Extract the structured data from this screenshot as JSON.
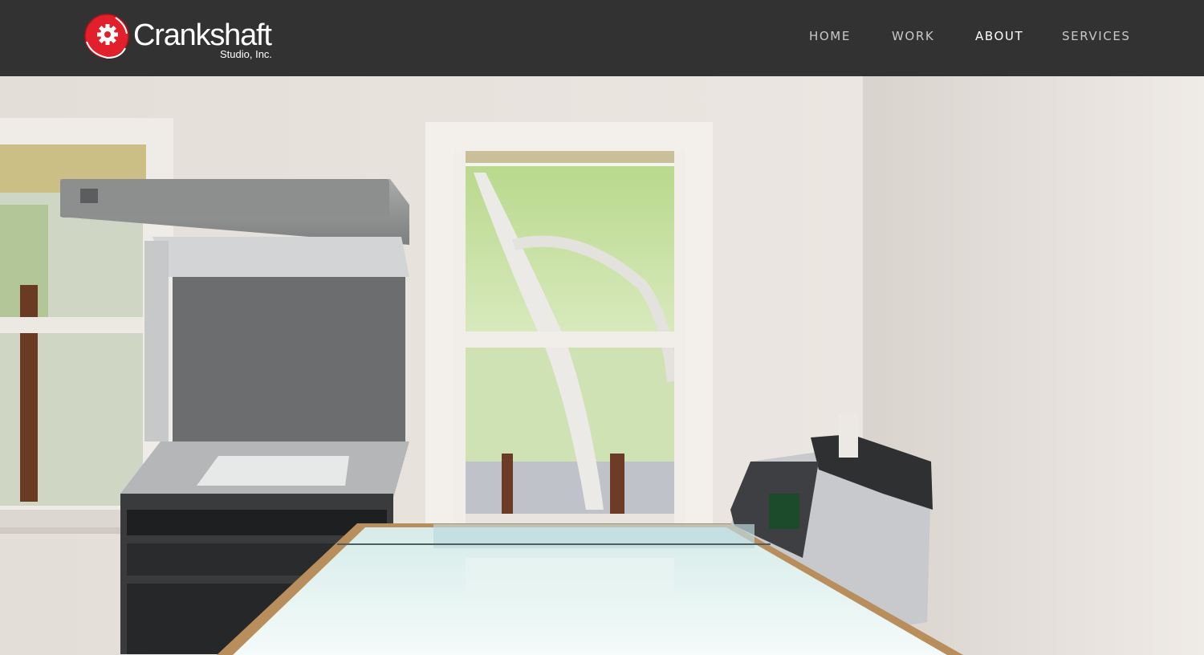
{
  "header": {
    "logo": {
      "name": "Crankshaft",
      "subtitle": "Studio, Inc.",
      "icon": "crankshaft-logo-icon",
      "brand_color": "#e2202b"
    },
    "nav": {
      "items": [
        {
          "label": "HOME",
          "active": false
        },
        {
          "label": "WORK",
          "active": false
        },
        {
          "label": "ABOUT",
          "active": true
        },
        {
          "label": "SERVICES",
          "active": false
        }
      ]
    },
    "background_color": "#333232"
  },
  "hero": {
    "scene": "studio-room-photo"
  }
}
